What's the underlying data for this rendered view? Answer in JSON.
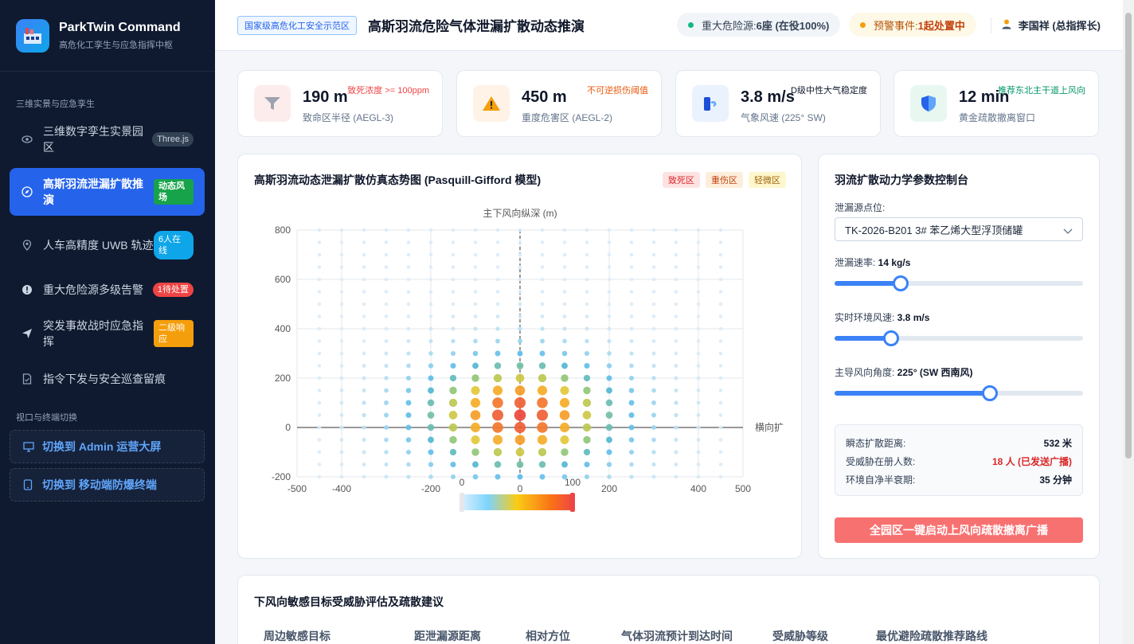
{
  "sidebar": {
    "brand_title": "ParkTwin Command",
    "brand_subtitle": "高危化工孪生与应急指挥中枢",
    "section1": "三维实景与应急孪生",
    "section2": "视口与终端切换",
    "items": [
      {
        "label": "三维数字孪生实景园区",
        "badge": "Three.js",
        "icon": "eye-icon"
      },
      {
        "label": "高斯羽流泄漏扩散推演",
        "badge": "动态风场",
        "icon": "compass-icon"
      },
      {
        "label": "人车高精度 UWB 轨迹",
        "badge": "6人在线",
        "icon": "location-pin-icon"
      },
      {
        "label": "重大危险源多级告警",
        "badge": "1待处置",
        "icon": "alert-icon"
      },
      {
        "label": "突发事故战时应急指挥",
        "badge": "二级响应",
        "icon": "send-icon"
      },
      {
        "label": "指令下发与安全巡查留痕",
        "badge": "",
        "icon": "document-icon"
      }
    ],
    "switch_admin": "切换到 Admin 运营大屏",
    "switch_mobile": "切换到 移动端防爆终端"
  },
  "header": {
    "tag": "国家级高危化工安全示范区",
    "title": "高斯羽流危险气体泄漏扩散动态推演",
    "hazard_label": "重大危险源: ",
    "hazard_value": "6座 (在役100%)",
    "alert_label": "预警事件: ",
    "alert_value": "1起处置中",
    "user": "李国祥 (总指挥长)"
  },
  "kpis": [
    {
      "value": "190 m",
      "label": "致命区半径 (AEGL-3)",
      "note": "致死浓度 >= 100ppm",
      "icon": "funnel-icon"
    },
    {
      "value": "450 m",
      "label": "重度危害区 (AEGL-2)",
      "note": "不可逆损伤阈值",
      "icon": "warning-icon"
    },
    {
      "value": "3.8 m/s",
      "label": "气象风速 (225° SW)",
      "note": "D级中性大气稳定度",
      "icon": "wind-icon"
    },
    {
      "value": "12 min",
      "label": "黄金疏散撤离窗口",
      "note": "推荐东北主干道上风向",
      "icon": "shield-icon"
    }
  ],
  "plume": {
    "title": "高斯羽流动态泄漏扩散仿真态势图 (Pasquill-Gifford 模型)",
    "legend": [
      "致死区",
      "重伤区",
      "轻微区"
    ],
    "colorbar_min": "0",
    "colorbar_max": "100"
  },
  "chart_data": {
    "type": "scatter",
    "ylabel": "主下风向纵深 (m)",
    "xlabel": "横向扩",
    "xlim": [
      -500,
      500
    ],
    "ylim": [
      -200,
      800
    ],
    "x_ticks": [
      -500,
      -400,
      -200,
      0,
      200,
      400,
      500
    ],
    "y_ticks": [
      -200,
      0,
      200,
      400,
      600,
      800
    ],
    "grid": true,
    "colorbar": [
      0,
      100
    ],
    "source": [
      0,
      50
    ],
    "sigma_x": 150,
    "sigma_y": 150
  },
  "controls": {
    "title": "羽流扩散动力学参数控制台",
    "source_label": "泄漏源点位:",
    "source_value": "TK-2026-B201 3# 苯乙烯大型浮顶储罐",
    "rate_label": "泄漏速率: ",
    "rate_value": "14 kg/s",
    "rate_level": 0.265,
    "wind_label": "实时环境风速: ",
    "wind_value": "3.8 m/s",
    "wind_level": 0.228,
    "dir_label": "主导风向角度: ",
    "dir_value": "225° (SW 西南风)",
    "dir_level": 0.625,
    "stats": [
      {
        "label": "瞬态扩散距离:",
        "value": "532 米"
      },
      {
        "label": "受威胁在册人数:",
        "value": "18 人 (已发送广播)"
      },
      {
        "label": "环境自净半衰期:",
        "value": "35 分钟"
      }
    ],
    "broadcast": "全园区一键启动上风向疏散撤离广播"
  },
  "targets": {
    "title": "下风向敏感目标受威胁评估及疏散建议",
    "headers": [
      "周边敏感目标",
      "距泄漏源距离",
      "相对方位",
      "气体羽流预计到达时间",
      "受威胁等级",
      "最优避险疏散推荐路线"
    ]
  },
  "colors": {
    "primary": "#2563eb",
    "danger": "#ef4444",
    "sidebar": "#0f1a30"
  }
}
